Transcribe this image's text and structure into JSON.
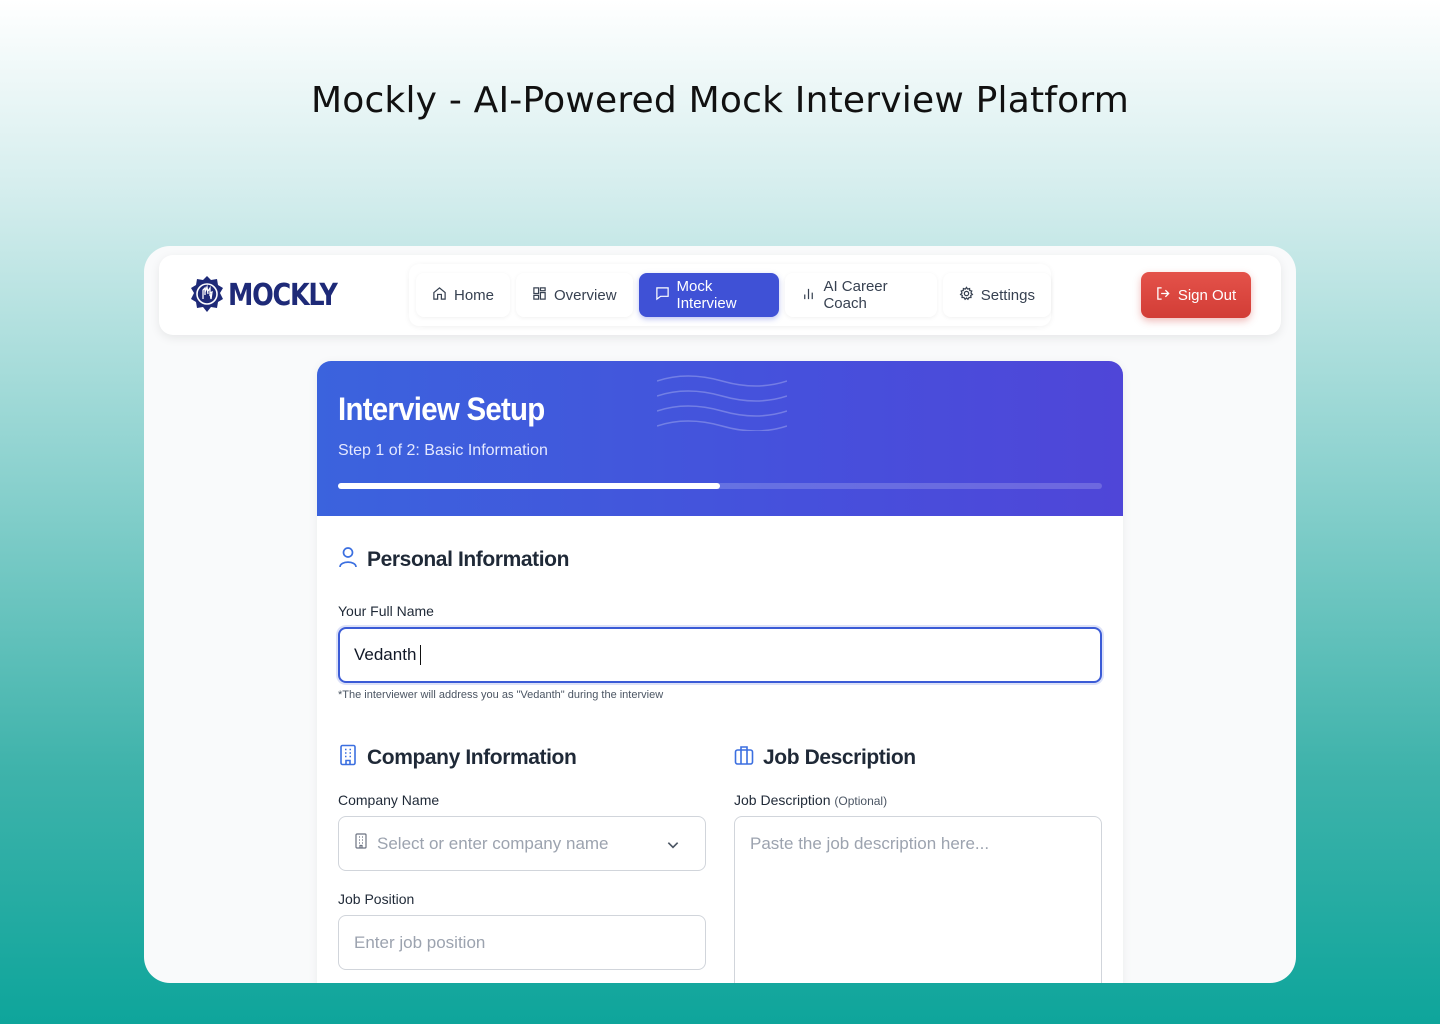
{
  "page_heading": "Mockly - AI-Powered Mock Interview Platform",
  "brand": {
    "name": "MOCKLY"
  },
  "nav": {
    "items": [
      {
        "label": "Home",
        "icon": "home-icon",
        "active": false
      },
      {
        "label": "Overview",
        "icon": "grid-icon",
        "active": false
      },
      {
        "label": "Mock Interview",
        "icon": "message-icon",
        "active": true
      },
      {
        "label": "AI Career Coach",
        "icon": "bar-chart-icon",
        "active": false
      },
      {
        "label": "Settings",
        "icon": "gear-icon",
        "active": false
      }
    ],
    "sign_out": "Sign Out"
  },
  "setup": {
    "title": "Interview Setup",
    "step": "Step 1 of 2: Basic Information",
    "progress": 0.5
  },
  "personal": {
    "title": "Personal Information",
    "name_label": "Your Full Name",
    "name_value": "Vedanth",
    "hint": "*The interviewer will address you as \"Vedanth\" during the interview"
  },
  "company": {
    "title": "Company Information",
    "company_label": "Company Name",
    "company_placeholder": "Select or enter company name",
    "position_label": "Job Position",
    "position_placeholder": "Enter job position"
  },
  "job": {
    "title": "Job Description",
    "label": "Job Description",
    "optional": "(Optional)",
    "placeholder": "Paste the job description here..."
  },
  "colors": {
    "accent": "#3f51d6",
    "danger": "#d23d36",
    "brand": "#1e2a78"
  }
}
